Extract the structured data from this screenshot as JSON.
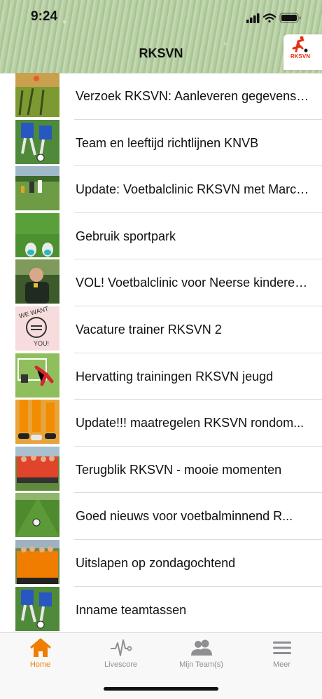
{
  "status": {
    "time": "9:24"
  },
  "header": {
    "title": "RKSVN",
    "logo_text": "RKSVN"
  },
  "news": [
    {
      "title": "Verzoek RKSVN: Aanleveren gegevens voor..."
    },
    {
      "title": "Team en leeftijd richtlijnen KNVB"
    },
    {
      "title": "Update: Voetbalclinic RKSVN met Marco..."
    },
    {
      "title": "Gebruik sportpark"
    },
    {
      "title": "VOL! Voetbalclinic voor Neerse kinderen..."
    },
    {
      "title": "Vacature trainer RKSVN 2"
    },
    {
      "title": "Hervatting trainingen RKSVN jeugd"
    },
    {
      "title": "Update!!! maatregelen RKSVN rondom..."
    },
    {
      "title": "Terugblik RKSVN - mooie momenten"
    },
    {
      "title": "Goed nieuws voor voetbalminnend R..."
    },
    {
      "title": "Uitslapen op zondagochtend"
    },
    {
      "title": "Inname teamtassen"
    }
  ],
  "tabs": [
    {
      "label": "Home",
      "icon": "home-icon"
    },
    {
      "label": "Livescore",
      "icon": "pulse-icon"
    },
    {
      "label": "Mijn Team(s)",
      "icon": "team-icon"
    },
    {
      "label": "Meer",
      "icon": "menu-icon"
    }
  ],
  "colors": {
    "accent": "#f07d00",
    "inactive": "#8e8e93",
    "brand_red": "#e63312"
  }
}
